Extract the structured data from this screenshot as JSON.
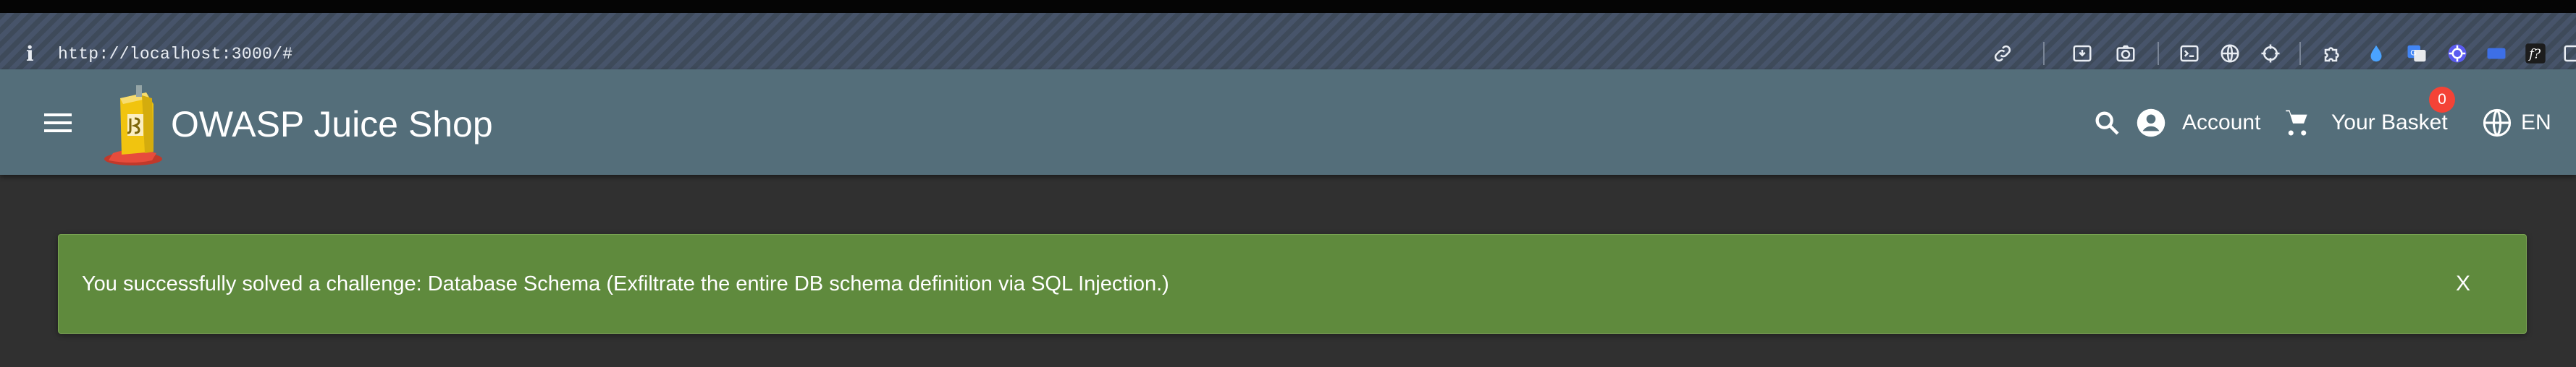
{
  "browser": {
    "info_glyph": "i",
    "url": "http://localhost:3000/#"
  },
  "toolbar_icons": [
    "link-icon",
    "downloader-icon",
    "screenshot-icon",
    "terminal-icon",
    "globe-icon",
    "crosshair-icon",
    "puzzle-icon",
    "droplet-icon",
    "translate-icon",
    "gear-wheel-icon",
    "screen-icon",
    "fx-icon",
    "sidebar-icon"
  ],
  "app": {
    "title": "OWASP Juice Shop",
    "account_label": "Account",
    "basket_label": "Your Basket",
    "basket_count": "0",
    "language": "EN",
    "colors": {
      "app_bar": "#546e7a",
      "page_background": "#303030",
      "success": "#5f8a3d",
      "badge": "#f44336"
    }
  },
  "notification": {
    "message": "You successfully solved a challenge: Database Schema (Exfiltrate the entire DB schema definition via SQL Injection.)",
    "close_label": "X"
  }
}
